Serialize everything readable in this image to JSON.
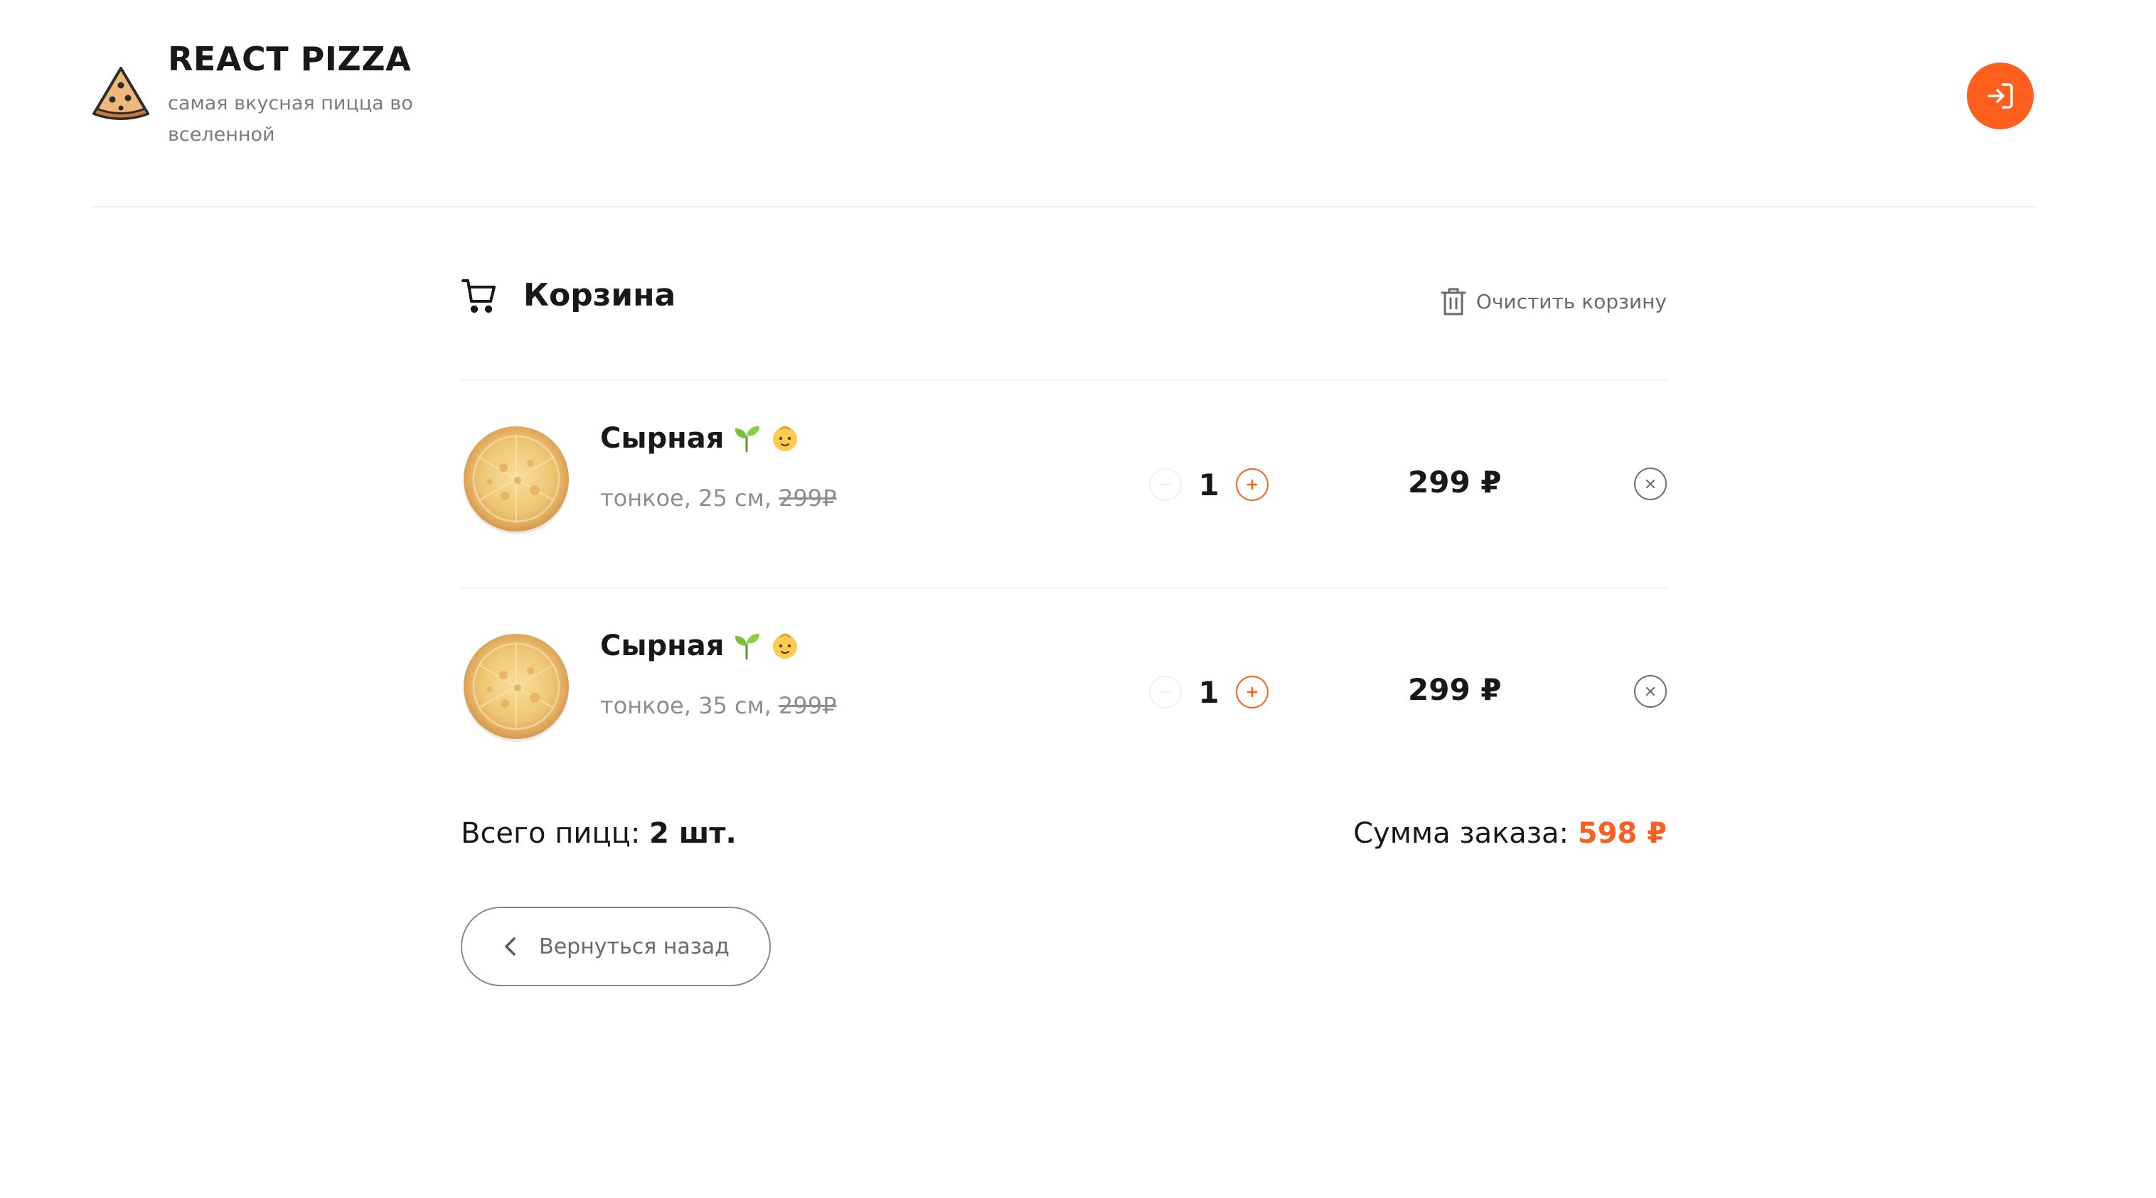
{
  "header": {
    "title": "REACT PIZZA",
    "subtitle": "самая вкусная пицца во вселенной"
  },
  "cart": {
    "title": "Корзина",
    "clear_label": "Очистить корзину",
    "items": [
      {
        "name": "Сырная",
        "tags": [
          "seedling-icon",
          "baby-icon"
        ],
        "desc": "тонкое, 25 см, ",
        "old_price": "299₽",
        "count": "1",
        "price": "299 ₽"
      },
      {
        "name": "Сырная",
        "tags": [
          "seedling-icon",
          "baby-icon"
        ],
        "desc": "тонкое, 35 см, ",
        "old_price": "299₽",
        "count": "1",
        "price": "299 ₽"
      }
    ],
    "summary": {
      "count_label": "Всего пицц: ",
      "count_value": "2 шт.",
      "sum_label": "Сумма заказа: ",
      "sum_value": "598 ₽"
    },
    "back_label": "Вернуться назад"
  },
  "colors": {
    "accent": "#fe5f1e",
    "text": "#181818",
    "muted": "#8d8d8d"
  }
}
